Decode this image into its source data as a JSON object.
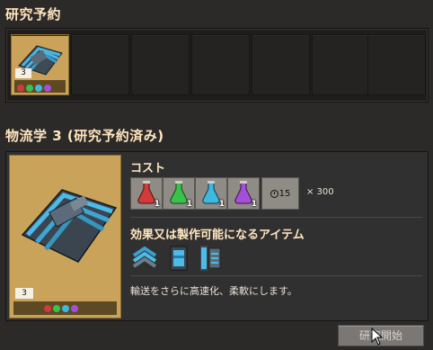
{
  "queue": {
    "title": "研究予約",
    "items": [
      {
        "level": "3",
        "filled": true
      },
      {
        "filled": false
      },
      {
        "filled": false
      },
      {
        "filled": false
      },
      {
        "filled": false
      },
      {
        "filled": false
      },
      {
        "filled": false
      }
    ]
  },
  "tech": {
    "title": "物流学 3 (研究予約済み)",
    "level": "3",
    "cost_label": "コスト",
    "ingredients": [
      {
        "name": "red-science-pack-icon",
        "count": "1",
        "color": "#d33a3a"
      },
      {
        "name": "green-science-pack-icon",
        "count": "1",
        "color": "#3bc24a"
      },
      {
        "name": "blue-science-pack-icon",
        "count": "1",
        "color": "#3fb8e0"
      },
      {
        "name": "purple-science-pack-icon",
        "count": "1",
        "color": "#a44fd6"
      }
    ],
    "time": "15",
    "multiplier": "× 300",
    "effects_label": "効果又は製作可能になるアイテム",
    "effects": [
      "express-transport-belt-icon",
      "express-underground-belt-icon",
      "express-splitter-icon"
    ],
    "description": "輸送をさらに高速化、柔軟にします。"
  },
  "start_button": "研究開始",
  "colors": {
    "accent_title": "#ffe6c0",
    "slot_background": "#caa25a"
  }
}
